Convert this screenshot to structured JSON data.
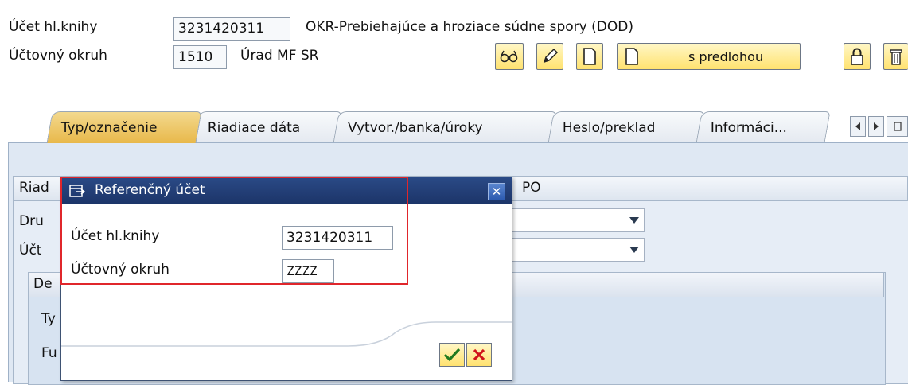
{
  "header": {
    "account_label": "Účet hl.knihy",
    "account_value": "3231420311",
    "account_desc": "OKR-Prebiehajúce a hroziace súdne spory (DOD)",
    "area_label": "Účtovný okruh",
    "area_value": "1510",
    "area_desc": "Úrad MF SR"
  },
  "toolbar": {
    "with_template_label": "s predlohou",
    "icons": [
      "glasses-icon",
      "pencil-icon",
      "new-document-icon",
      "new-document-template-icon",
      "lock-icon",
      "trash-icon"
    ]
  },
  "tabs": [
    {
      "label": "Typ/označenie",
      "active": true
    },
    {
      "label": "Riadiace dáta",
      "active": false
    },
    {
      "label": "Vytvor./banka/úroky",
      "active": false
    },
    {
      "label": "Heslo/preklad",
      "active": false
    },
    {
      "label": "Informáci...",
      "active": false
    }
  ],
  "panel": {
    "group_title_partial": "Riad",
    "group_title_right": "PO",
    "row1_label_partial": "Dru",
    "row2_label_partial": "Účt",
    "sub_title_partial": "De",
    "sub_row1_partial": "Ty",
    "sub_row2_partial": "Fu"
  },
  "dialog": {
    "title": "Referenčný účet",
    "account_label": "Účet hl.knihy",
    "account_value": "3231420311",
    "area_label": "Účtovný okruh",
    "area_value": "ZZZZ"
  },
  "colors": {
    "title_bar": "#1c3468",
    "highlight": "#e0262b",
    "active_tab": "#e8b84a",
    "panel": "#dfe8f3"
  }
}
